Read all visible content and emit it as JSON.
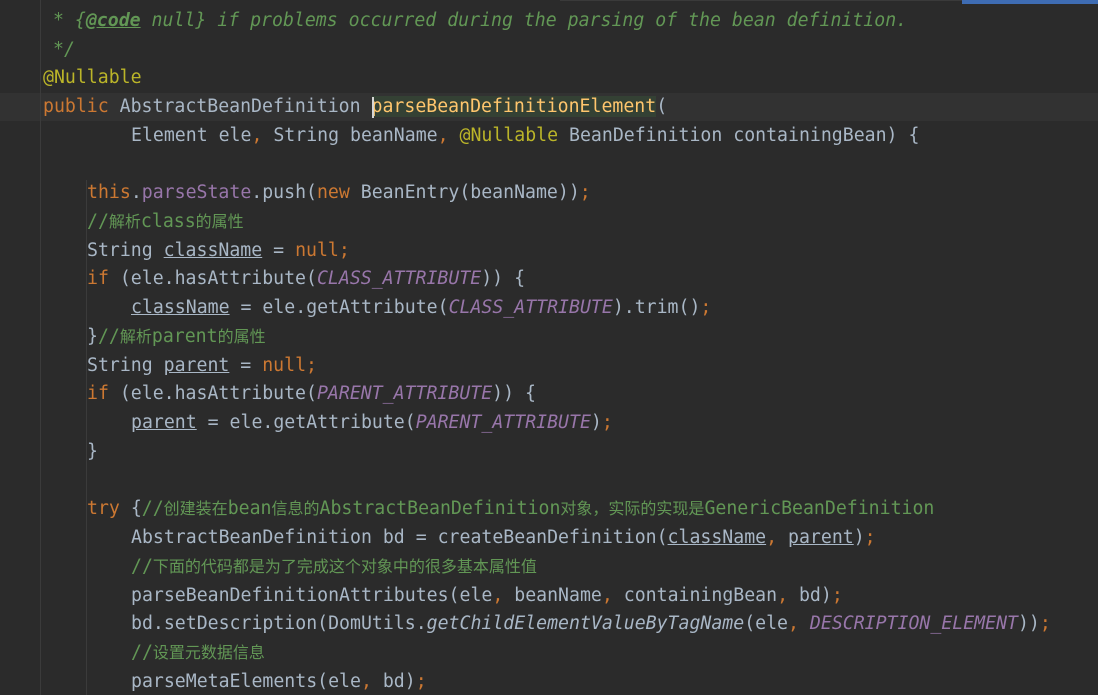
{
  "editor": {
    "colors": {
      "background": "#2b2b2b",
      "comment": "#629755",
      "keyword": "#cc7832",
      "annotation": "#bbb529",
      "method_decl": "#ffc66d",
      "field": "#9876aa",
      "plain": "#a9b7c6"
    },
    "lines": [
      {
        "tokens": [
          {
            "c": "cmt",
            "t": "* {"
          },
          {
            "c": "cmt-tag",
            "t": "@code"
          },
          {
            "c": "cmt",
            "t": " null} if problems occurred during the parsing of the bean definition."
          }
        ]
      },
      {
        "tokens": [
          {
            "c": "cmt",
            "t": "*/"
          }
        ]
      },
      {
        "tokens": [
          {
            "c": "ann",
            "t": "@Nullable"
          }
        ]
      },
      {
        "tokens": [
          {
            "c": "kw",
            "t": "public "
          },
          {
            "c": "plain",
            "t": "AbstractBeanDefinition "
          },
          {
            "c": "fn hl-fn",
            "t": "parseBeanDefinitionElement"
          },
          {
            "c": "plain",
            "t": "("
          }
        ]
      },
      {
        "tokens": [
          {
            "c": "plain",
            "t": "Element ele"
          },
          {
            "c": "kw",
            "t": ", "
          },
          {
            "c": "plain",
            "t": "String beanName"
          },
          {
            "c": "kw",
            "t": ", "
          },
          {
            "c": "ann",
            "t": "@Nullable "
          },
          {
            "c": "plain",
            "t": "BeanDefinition containingBean) {"
          }
        ]
      },
      {
        "tokens": [
          {
            "c": "kw",
            "t": "this"
          },
          {
            "c": "plain",
            "t": "."
          },
          {
            "c": "fld",
            "t": "parseState"
          },
          {
            "c": "plain",
            "t": ".push("
          },
          {
            "c": "kw",
            "t": "new "
          },
          {
            "c": "plain",
            "t": "BeanEntry(beanName))"
          },
          {
            "c": "kw",
            "t": ";"
          }
        ]
      },
      {
        "tokens": [
          {
            "c": "lcm",
            "t": "//"
          },
          {
            "c": "lcm-cjk",
            "t": "解析"
          },
          {
            "c": "lcm",
            "t": "class"
          },
          {
            "c": "lcm-cjk",
            "t": "的属性"
          }
        ]
      },
      {
        "tokens": [
          {
            "c": "plain",
            "t": "String "
          },
          {
            "c": "plain var-u",
            "t": "className"
          },
          {
            "c": "plain",
            "t": " = "
          },
          {
            "c": "kw",
            "t": "null;"
          }
        ]
      },
      {
        "tokens": [
          {
            "c": "kw",
            "t": "if "
          },
          {
            "c": "plain",
            "t": "(ele.hasAttribute("
          },
          {
            "c": "cst",
            "t": "CLASS_ATTRIBUTE"
          },
          {
            "c": "plain",
            "t": ")) {"
          }
        ]
      },
      {
        "tokens": [
          {
            "c": "plain var-u",
            "t": "className"
          },
          {
            "c": "plain",
            "t": " = ele.getAttribute("
          },
          {
            "c": "cst",
            "t": "CLASS_ATTRIBUTE"
          },
          {
            "c": "plain",
            "t": ").trim()"
          },
          {
            "c": "kw",
            "t": ";"
          }
        ]
      },
      {
        "tokens": [
          {
            "c": "plain",
            "t": "}"
          },
          {
            "c": "lcm",
            "t": "//"
          },
          {
            "c": "lcm-cjk",
            "t": "解析"
          },
          {
            "c": "lcm",
            "t": "parent"
          },
          {
            "c": "lcm-cjk",
            "t": "的属性"
          }
        ]
      },
      {
        "tokens": [
          {
            "c": "plain",
            "t": "String "
          },
          {
            "c": "plain var-u",
            "t": "parent"
          },
          {
            "c": "plain",
            "t": " = "
          },
          {
            "c": "kw",
            "t": "null;"
          }
        ]
      },
      {
        "tokens": [
          {
            "c": "kw",
            "t": "if "
          },
          {
            "c": "plain",
            "t": "(ele.hasAttribute("
          },
          {
            "c": "cst",
            "t": "PARENT_ATTRIBUTE"
          },
          {
            "c": "plain",
            "t": ")) {"
          }
        ]
      },
      {
        "tokens": [
          {
            "c": "plain var-u",
            "t": "parent"
          },
          {
            "c": "plain",
            "t": " = ele.getAttribute("
          },
          {
            "c": "cst",
            "t": "PARENT_ATTRIBUTE"
          },
          {
            "c": "plain",
            "t": ")"
          },
          {
            "c": "kw",
            "t": ";"
          }
        ]
      },
      {
        "tokens": [
          {
            "c": "plain",
            "t": "}"
          }
        ]
      },
      {
        "tokens": [
          {
            "c": "kw",
            "t": "try "
          },
          {
            "c": "plain",
            "t": "{"
          },
          {
            "c": "lcm",
            "t": "//"
          },
          {
            "c": "lcm-cjk",
            "t": "创建装在"
          },
          {
            "c": "lcm",
            "t": "bean"
          },
          {
            "c": "lcm-cjk",
            "t": "信息的"
          },
          {
            "c": "lcm",
            "t": "AbstractBeanDefinition"
          },
          {
            "c": "lcm-cjk",
            "t": "对象，实际的实现是"
          },
          {
            "c": "lcm",
            "t": "GenericBeanDefinition"
          }
        ]
      },
      {
        "tokens": [
          {
            "c": "plain",
            "t": "AbstractBeanDefinition bd = createBeanDefinition("
          },
          {
            "c": "plain var-u",
            "t": "className"
          },
          {
            "c": "kw",
            "t": ", "
          },
          {
            "c": "plain var-u",
            "t": "parent"
          },
          {
            "c": "plain",
            "t": ")"
          },
          {
            "c": "kw",
            "t": ";"
          }
        ]
      },
      {
        "tokens": [
          {
            "c": "lcm",
            "t": "//"
          },
          {
            "c": "lcm-cjk",
            "t": "下面的代码都是为了完成这个对象中的很多基本属性值"
          }
        ]
      },
      {
        "tokens": [
          {
            "c": "plain",
            "t": "parseBeanDefinitionAttributes(ele"
          },
          {
            "c": "kw",
            "t": ", "
          },
          {
            "c": "plain",
            "t": "beanName"
          },
          {
            "c": "kw",
            "t": ", "
          },
          {
            "c": "plain",
            "t": "containingBean"
          },
          {
            "c": "kw",
            "t": ", "
          },
          {
            "c": "plain",
            "t": "bd)"
          },
          {
            "c": "kw",
            "t": ";"
          }
        ]
      },
      {
        "tokens": [
          {
            "c": "plain",
            "t": "bd.setDescription(DomUtils."
          },
          {
            "c": "plain smeth",
            "t": "getChildElementValueByTagName"
          },
          {
            "c": "plain",
            "t": "(ele"
          },
          {
            "c": "kw",
            "t": ", "
          },
          {
            "c": "cst",
            "t": "DESCRIPTION_ELEMENT"
          },
          {
            "c": "plain",
            "t": "))"
          },
          {
            "c": "kw",
            "t": ";"
          }
        ]
      },
      {
        "tokens": [
          {
            "c": "lcm",
            "t": "//"
          },
          {
            "c": "lcm-cjk",
            "t": "设置元数据信息"
          }
        ]
      },
      {
        "tokens": [
          {
            "c": "plain",
            "t": "parseMetaElements(ele"
          },
          {
            "c": "kw",
            "t": ", "
          },
          {
            "c": "plain",
            "t": "bd)"
          },
          {
            "c": "kw",
            "t": ";"
          }
        ]
      }
    ]
  }
}
